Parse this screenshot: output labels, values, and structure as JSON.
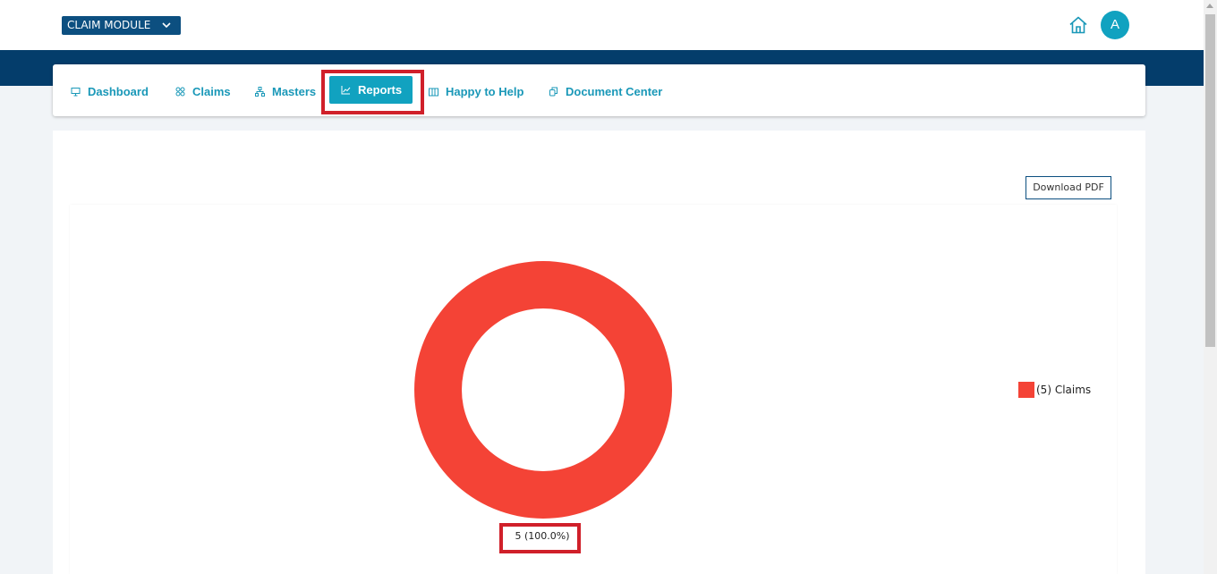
{
  "header": {
    "module_label": "CLAIM MODULE",
    "avatar_initial": "A",
    "home_icon": "home-icon",
    "module_dropdown_icon": "chevron-down-icon"
  },
  "nav": {
    "items": [
      {
        "label": "Dashboard",
        "icon": "monitor-icon"
      },
      {
        "label": "Claims",
        "icon": "grid-icon"
      },
      {
        "label": "Masters",
        "icon": "sitemap-icon"
      },
      {
        "label": "Reports",
        "icon": "chart-line-icon",
        "active": true
      },
      {
        "label": "Happy to Help",
        "icon": "book-icon"
      },
      {
        "label": "Document Center",
        "icon": "copy-icon"
      }
    ]
  },
  "toolbar": {
    "download_label": "Download PDF"
  },
  "chart_data": {
    "type": "pie",
    "donut": true,
    "categories": [
      "Claims"
    ],
    "values": [
      5
    ],
    "colors": [
      "#f44336"
    ],
    "data_labels": [
      "5 (100.0%)"
    ],
    "legend": {
      "position": "right",
      "entries": [
        "(5)  Claims"
      ]
    }
  },
  "colors": {
    "brand_dark": "#043d6b",
    "accent": "#11a2c0",
    "highlight": "#d0202a"
  }
}
